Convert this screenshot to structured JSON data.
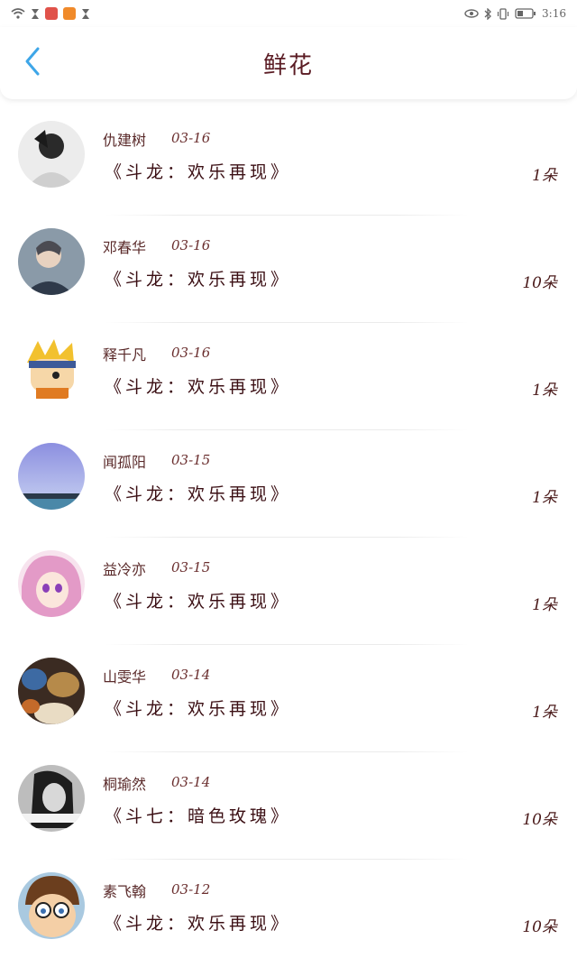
{
  "status_bar": {
    "time": "3:16",
    "icons_left": [
      "wifi-icon",
      "hourglass-icon",
      "app-red-icon",
      "app-orange-icon",
      "hourglass-icon"
    ],
    "icons_right": [
      "eye-icon",
      "bluetooth-icon",
      "vibrate-icon",
      "battery-icon"
    ]
  },
  "header": {
    "title": "鲜花",
    "back_icon": "chevron-left-icon"
  },
  "colors": {
    "accent": "#3ea6e8",
    "title": "#5a1b23",
    "text": "#3b0f14"
  },
  "gifts": [
    {
      "name": "仇建树",
      "date": "03-16",
      "book": "《斗龙：欢乐再现》",
      "count": "1朵"
    },
    {
      "name": "邓春华",
      "date": "03-16",
      "book": "《斗龙：欢乐再现》",
      "count": "10朵"
    },
    {
      "name": "释千凡",
      "date": "03-16",
      "book": "《斗龙：欢乐再现》",
      "count": "1朵"
    },
    {
      "name": "闻孤阳",
      "date": "03-15",
      "book": "《斗龙：欢乐再现》",
      "count": "1朵"
    },
    {
      "name": "益冷亦",
      "date": "03-15",
      "book": "《斗龙：欢乐再现》",
      "count": "1朵"
    },
    {
      "name": "山雯华",
      "date": "03-14",
      "book": "《斗龙：欢乐再现》",
      "count": "1朵"
    },
    {
      "name": "桐瑜然",
      "date": "03-14",
      "book": "《斗七：暗色玫瑰》",
      "count": "10朵"
    },
    {
      "name": "素飞翰",
      "date": "03-12",
      "book": "《斗龙：欢乐再现》",
      "count": "10朵"
    }
  ]
}
